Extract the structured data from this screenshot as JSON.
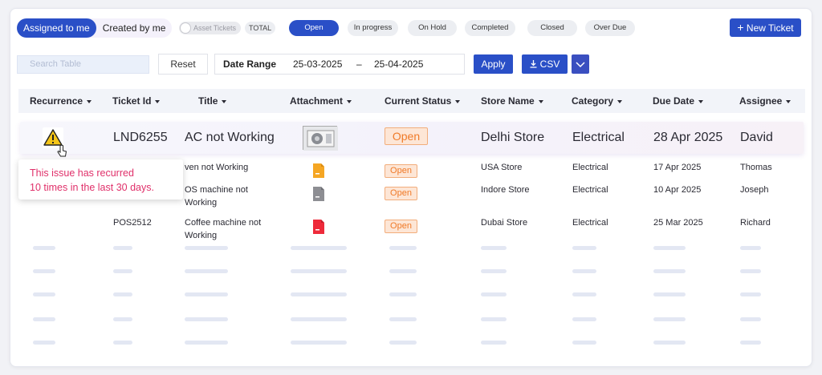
{
  "filters": {
    "assigned_to_me": "Assigned to me",
    "created_by_me": "Created by me",
    "asset_tickets": "Asset Tickets",
    "total": "TOTAL",
    "statuses": [
      "Open",
      "In progress",
      "On Hold",
      "Completed",
      "Closed",
      "Over Due"
    ],
    "active_status": "Open",
    "new_ticket": "New Ticket"
  },
  "toolbar": {
    "search_placeholder": "Search Table",
    "reset": "Reset",
    "date_range_label": "Date Range",
    "date_from": "25-03-2025",
    "date_sep": "–",
    "date_to": "25-04-2025",
    "apply": "Apply",
    "csv": "CSV"
  },
  "columns": [
    "Recurrence",
    "Ticket Id",
    "Title",
    "Attachment",
    "Current Status",
    "Store Name",
    "Category",
    "Due Date",
    "Assignee"
  ],
  "rows": [
    {
      "ticket_id": "LND6255",
      "title": "AC not Working",
      "status": "Open",
      "store": "Delhi Store",
      "category": "Electrical",
      "due_date": "28 Apr 2025",
      "assignee": "David",
      "attachment": "ac-unit-image"
    },
    {
      "ticket_id": "",
      "title_line1": "ven not Working",
      "title_line2": "",
      "status": "Open",
      "store": "USA Store",
      "category": "Electrical",
      "due_date": "17 Apr 2025",
      "assignee": "Thomas",
      "attachment": "file-yellow-icon"
    },
    {
      "ticket_id": "",
      "title_line1": "OS machine not",
      "title_line2": "Working",
      "status": "Open",
      "store": "Indore Store",
      "category": "Electrical",
      "due_date": "10 Apr 2025",
      "assignee": "Joseph",
      "attachment": "file-gray-icon"
    },
    {
      "ticket_id": "POS2512",
      "title_line1": "Coffee machine not",
      "title_line2": "Working",
      "status": "Open",
      "store": "Dubai Store",
      "category": "Electrical",
      "due_date": "25 Mar 2025",
      "assignee": "Richard",
      "attachment": "file-red-icon"
    }
  ],
  "tooltip": {
    "line1": "This issue has recurred",
    "line2": "10 times in the last 30 days."
  },
  "colors": {
    "primary": "#2a4fc7",
    "status_open": "#f07a28",
    "tooltip_text": "#e0306a",
    "warning": "#f5c518"
  }
}
